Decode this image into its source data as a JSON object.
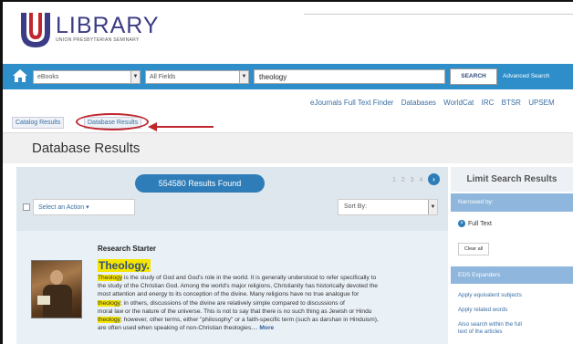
{
  "header": {
    "logo_big": "LIBRARY",
    "logo_small": "UNION PRESBYTERIAN SEMINARY"
  },
  "searchbar": {
    "source": "eBooks",
    "field": "All Fields",
    "query": "theology",
    "search_label": "SEARCH",
    "advanced_label": "Advanced Search"
  },
  "toplinks": [
    "eJournals Full Text Finder",
    "Databases",
    "WorldCat",
    "IRC",
    "BTSR",
    "UPSEM"
  ],
  "tabs": {
    "catalog": "Catalog Results",
    "database": "Database Results"
  },
  "page_title": "Database Results",
  "results": {
    "found": "554580 Results Found",
    "pages": "1 2 3 4 5",
    "action": "Select an Action",
    "sort_label": "Sort By:"
  },
  "starter": {
    "label": "Research Starter",
    "title": "Theology.",
    "lines": [
      [
        {
          "t": "Theology",
          "hl": true
        },
        {
          "t": " is the study of God and God's role in the world. It is generally understood to refer specifically to"
        }
      ],
      [
        {
          "t": "the study of the Christian God. Among the world's major religions, Christianity has historically devoted the"
        }
      ],
      [
        {
          "t": "most attention and energy to its conception of the divine. Many religions have no true analogue for"
        }
      ],
      [
        {
          "t": "theology",
          "hl": true
        },
        {
          "t": "; in others, discussions of the divine are relatively simple compared to discussions of"
        }
      ],
      [
        {
          "t": "moral law or the nature of the universe. This is not to say that there is no such thing as Jewish or Hindu"
        }
      ],
      [
        {
          "t": "theology",
          "hl": true
        },
        {
          "t": "; however, other terms, either \"philosophy\" or a faith-specific term (such as darshan in Hinduism),"
        }
      ],
      [
        {
          "t": "are often used when speaking of non-Christian theologies.... "
        },
        {
          "t": "More",
          "more": true
        }
      ]
    ]
  },
  "sidebar": {
    "title": "Limit Search Results",
    "narrowed_by": "Narrowed by:",
    "full_text": "Full Text",
    "clear_all": "Clear all",
    "expanders_title": "EDS Expanders",
    "expanders": [
      "Apply equivalent subjects",
      "Apply related words",
      "Also search within the full",
      "text of the articles"
    ]
  },
  "colors": {
    "brand_blue": "#2e8ec9",
    "annotation_red": "#c0262d",
    "highlight": "#f5e500"
  }
}
